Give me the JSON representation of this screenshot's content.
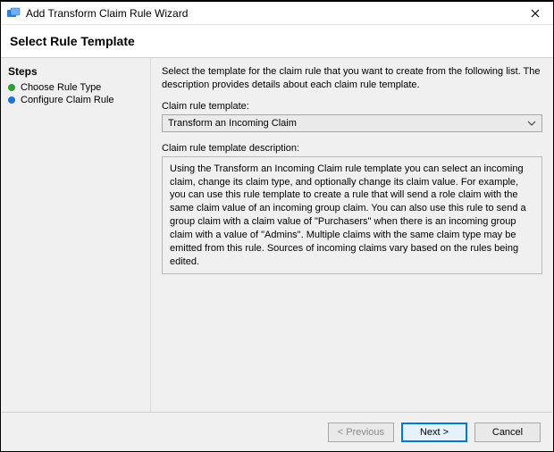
{
  "window": {
    "title": "Add Transform Claim Rule Wizard"
  },
  "header": {
    "title": "Select Rule Template"
  },
  "sidebar": {
    "title": "Steps",
    "items": [
      {
        "label": "Choose Rule Type",
        "bullet_color": "#2e9e2e"
      },
      {
        "label": "Configure Claim Rule",
        "bullet_color": "#1e73d6"
      }
    ]
  },
  "main": {
    "intro": "Select the template for the claim rule that you want to create from the following list. The description provides details about each claim rule template.",
    "template_label": "Claim rule template:",
    "template_selected": "Transform an Incoming Claim",
    "description_label": "Claim rule template description:",
    "description_text": "Using the Transform an Incoming Claim rule template you can select an incoming claim, change its claim type, and optionally change its claim value.  For example, you can use this rule template to create a rule that will send a role claim with the same claim value of an incoming group claim.  You can also use this rule to send a group claim with a claim value of \"Purchasers\" when there is an incoming group claim with a value of \"Admins\".  Multiple claims with the same claim type may be emitted from this rule.  Sources of incoming claims vary based on the rules being edited."
  },
  "footer": {
    "previous": "< Previous",
    "next": "Next >",
    "cancel": "Cancel"
  }
}
